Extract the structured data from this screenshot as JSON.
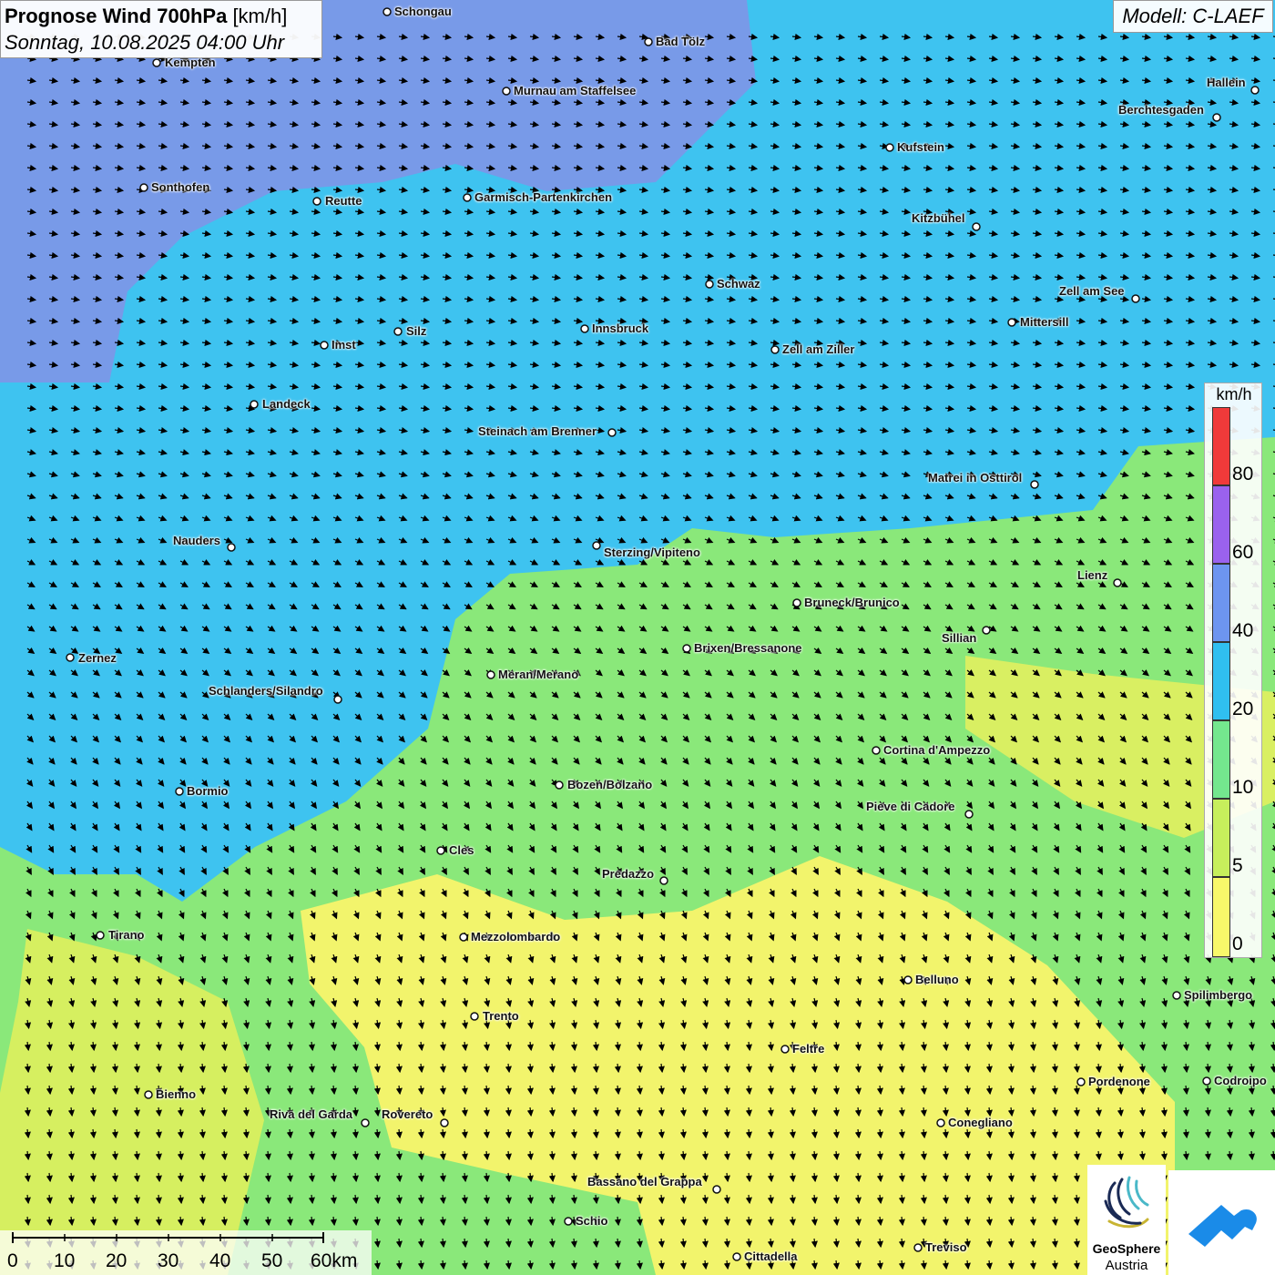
{
  "header": {
    "title_bold": "Prognose Wind 700hPa",
    "title_unit": "[km/h]",
    "datetime": "Sonntag, 10.08.2025 04:00 Uhr"
  },
  "model": "Modell: C-LAEF",
  "legend": {
    "unit": "km/h",
    "labels": [
      "80",
      "60",
      "40",
      "20",
      "10",
      "5",
      "0"
    ],
    "colors": {
      "above_80": "#f03a3a",
      "60_80": "#9a62ee",
      "40_60": "#6d95f0",
      "20_40": "#30bff0",
      "10_20": "#74e78e",
      "5_10": "#c7ef5c",
      "0_5": "#f8f86a"
    }
  },
  "scale": {
    "labels": [
      "0",
      "10",
      "20",
      "30",
      "40",
      "50",
      "60km"
    ]
  },
  "logos": {
    "geosphere_line1": "GeoSphere",
    "geosphere_line2": "Austria"
  },
  "cities": [
    {
      "name": "Schongau"
    },
    {
      "name": "Bad Tölz"
    },
    {
      "name": "Kempten"
    },
    {
      "name": "Murnau am Staffelsee"
    },
    {
      "name": "Hallein"
    },
    {
      "name": "Berchtesgaden"
    },
    {
      "name": "Kufstein"
    },
    {
      "name": "Sonthofen"
    },
    {
      "name": "Reutte"
    },
    {
      "name": "Garmisch-Partenkirchen"
    },
    {
      "name": "Kitzbühel"
    },
    {
      "name": "Schwaz"
    },
    {
      "name": "Zell am See"
    },
    {
      "name": "Mittersill"
    },
    {
      "name": "Innsbruck"
    },
    {
      "name": "Silz"
    },
    {
      "name": "Imst"
    },
    {
      "name": "Zell am Ziller"
    },
    {
      "name": "Landeck"
    },
    {
      "name": "Steinach am Brenner"
    },
    {
      "name": "Matrei in Osttirol"
    },
    {
      "name": "Nauders"
    },
    {
      "name": "Sterzing/Vipiteno"
    },
    {
      "name": "Lienz"
    },
    {
      "name": "Bruneck/Brunico"
    },
    {
      "name": "Sillian"
    },
    {
      "name": "Brixen/Bressanone"
    },
    {
      "name": "Zernez"
    },
    {
      "name": "Meran/Merano"
    },
    {
      "name": "Schlanders/Silandro"
    },
    {
      "name": "Cortina d'Ampezzo"
    },
    {
      "name": "Bozen/Bolzano"
    },
    {
      "name": "Bormio"
    },
    {
      "name": "Pieve di Cadore"
    },
    {
      "name": "Cles"
    },
    {
      "name": "Predazzo"
    },
    {
      "name": "Tirano"
    },
    {
      "name": "Mezzolombardo"
    },
    {
      "name": "Belluno"
    },
    {
      "name": "Spilimbergo"
    },
    {
      "name": "Trento"
    },
    {
      "name": "Feltre"
    },
    {
      "name": "Bienno"
    },
    {
      "name": "Pordenone"
    },
    {
      "name": "Codroipo"
    },
    {
      "name": "Riva del Garda"
    },
    {
      "name": "Rovereto"
    },
    {
      "name": "Conegliano"
    },
    {
      "name": "Bassano del Grappa"
    },
    {
      "name": "Schio"
    },
    {
      "name": "Treviso"
    },
    {
      "name": "Cittadella"
    }
  ]
}
